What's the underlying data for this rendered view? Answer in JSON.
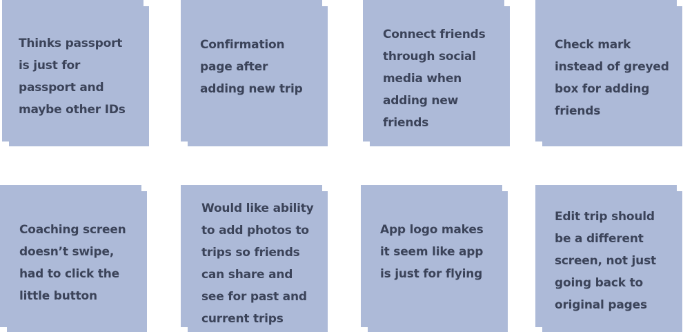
{
  "notes": [
    {
      "lines": [
        "Thinks passport",
        "is just for",
        "passport and",
        "maybe other IDs"
      ]
    },
    {
      "lines": [
        "Confirmation",
        "page after",
        "adding new trip"
      ]
    },
    {
      "lines": [
        "Connect friends",
        "through social",
        "media when",
        "adding new",
        "friends"
      ]
    },
    {
      "lines": [
        "Check mark",
        "instead of greyed",
        "box for adding",
        "friends"
      ]
    },
    {
      "lines": [
        "Coaching screen",
        "doesn’t swipe,",
        "had to click the",
        "little button"
      ]
    },
    {
      "lines": [
        "Would like ability",
        "to add photos to",
        "trips so friends",
        "can share and",
        "see for past and",
        "current trips"
      ]
    },
    {
      "lines": [
        "App logo makes",
        "it seem like app",
        "is just for flying"
      ]
    },
    {
      "lines": [
        "Edit trip should",
        "be a different",
        "screen, not just",
        "going back to",
        "original pages"
      ]
    }
  ],
  "colors": {
    "note_background": "#adbad8",
    "note_text": "#3b4359"
  }
}
